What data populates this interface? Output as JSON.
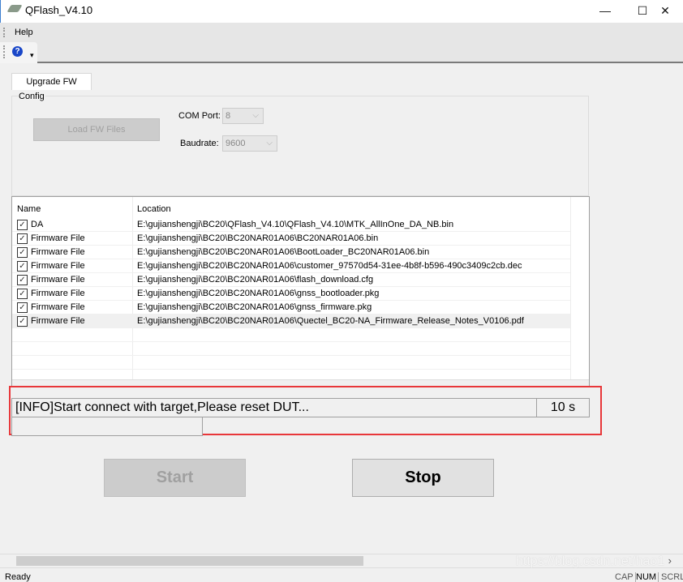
{
  "window": {
    "title": "QFlash_V4.10",
    "minimize": "—",
    "maximize": "☐",
    "close": "✕"
  },
  "menu": {
    "items": [
      "Help"
    ]
  },
  "toolbar": {
    "help_icon": "help-icon",
    "dropdown": "▾"
  },
  "tabs": [
    {
      "label": "Upgrade FW",
      "active": true
    }
  ],
  "config": {
    "group_label": "Config",
    "load_button": "Load FW Files",
    "com_port_label": "COM Port:",
    "com_port_value": "8",
    "baudrate_label": "Baudrate:",
    "baudrate_value": "9600"
  },
  "table": {
    "columns": [
      "Name",
      "Location"
    ],
    "rows": [
      {
        "checked": true,
        "name": "DA",
        "location": "E:\\gujianshengji\\BC20\\QFlash_V4.10\\QFlash_V4.10\\MTK_AllInOne_DA_NB.bin"
      },
      {
        "checked": true,
        "name": "Firmware File",
        "location": "E:\\gujianshengji\\BC20\\BC20NAR01A06\\BC20NAR01A06.bin"
      },
      {
        "checked": true,
        "name": "Firmware File",
        "location": "E:\\gujianshengji\\BC20\\BC20NAR01A06\\BootLoader_BC20NAR01A06.bin"
      },
      {
        "checked": true,
        "name": "Firmware File",
        "location": "E:\\gujianshengji\\BC20\\BC20NAR01A06\\customer_97570d54-31ee-4b8f-b596-490c3409c2cb.dec"
      },
      {
        "checked": true,
        "name": "Firmware File",
        "location": "E:\\gujianshengji\\BC20\\BC20NAR01A06\\flash_download.cfg"
      },
      {
        "checked": true,
        "name": "Firmware File",
        "location": "E:\\gujianshengji\\BC20\\BC20NAR01A06\\gnss_bootloader.pkg"
      },
      {
        "checked": true,
        "name": "Firmware File",
        "location": "E:\\gujianshengji\\BC20\\BC20NAR01A06\\gnss_firmware.pkg"
      },
      {
        "checked": true,
        "name": "Firmware File",
        "location": "E:\\gujianshengji\\BC20\\BC20NAR01A06\\Quectel_BC20-NA_Firmware_Release_Notes_V0106.pdf"
      }
    ]
  },
  "status": {
    "message": "[INFO]Start connect with target,Please reset DUT...",
    "timer": "10 s",
    "progress": 0,
    "highlight_color": "#e8373a"
  },
  "actions": {
    "start": "Start",
    "stop": "Stop"
  },
  "statusbar": {
    "text": "Ready",
    "indicators": [
      "CAP",
      "NUM",
      "SCRL"
    ]
  },
  "watermark": "https://blog.csdn.net/hao1"
}
